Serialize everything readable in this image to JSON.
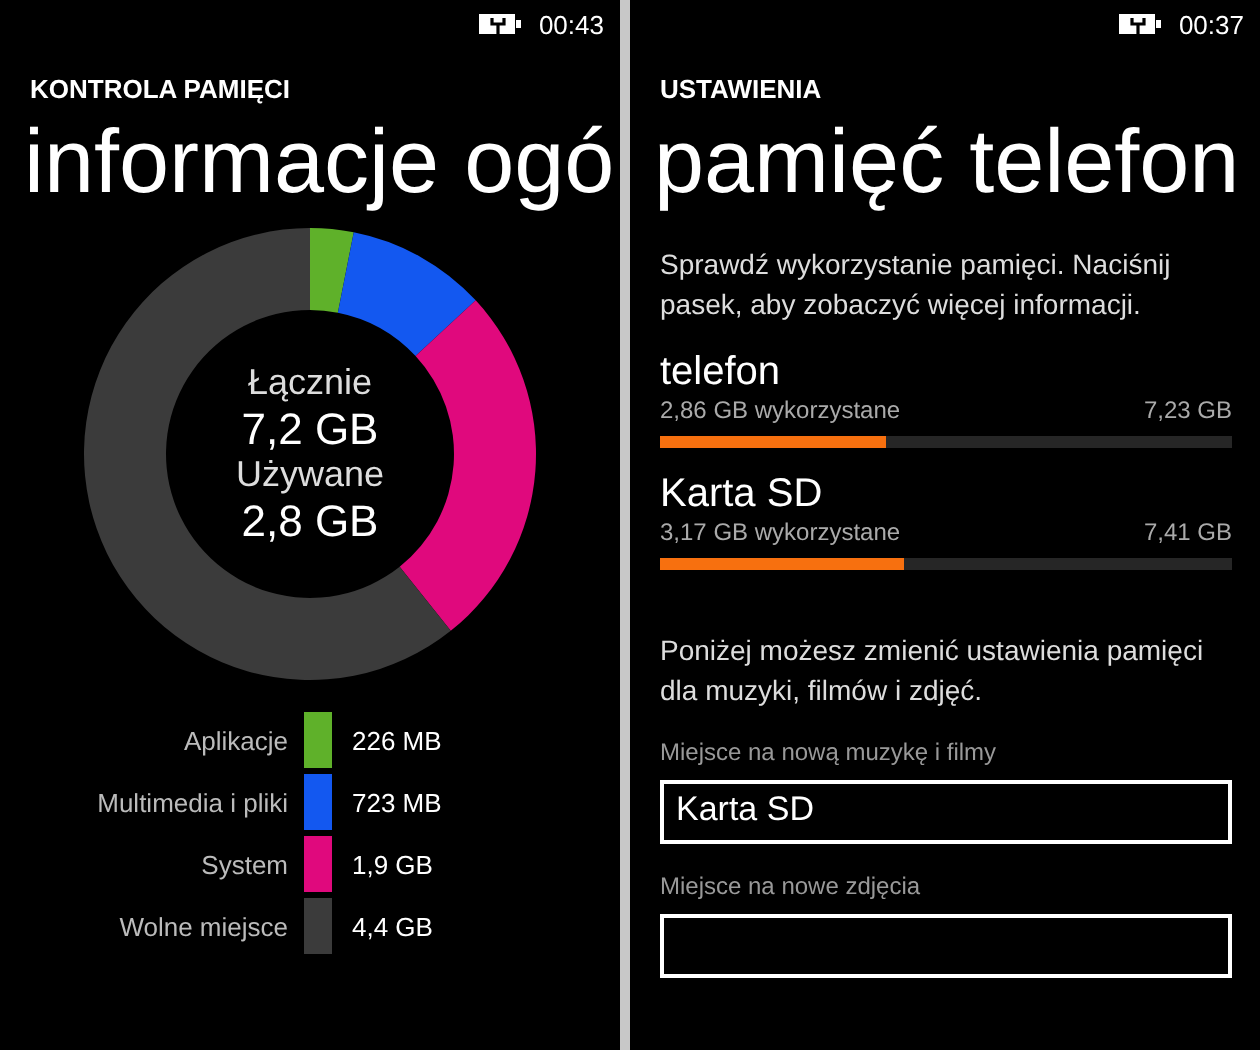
{
  "left": {
    "status_bar": {
      "time": "00:43"
    },
    "app_title": "KONTROLA PAMIĘCI",
    "page_title": "informacje ogó",
    "center": {
      "total_label": "Łącznie",
      "total": "7,2 GB",
      "used_label": "Używane",
      "used": "2,8 GB"
    },
    "chart_data": {
      "type": "donut",
      "categories": [
        "Aplikacje",
        "Multimedia i pliki",
        "System",
        "Wolne miejsce"
      ],
      "values": [
        3.1,
        10.0,
        26.2,
        60.7
      ]
    },
    "legend": [
      {
        "value": "226 MB",
        "color": "#5fb12a"
      },
      {
        "value": "723 MB",
        "color": "#1358f0"
      },
      {
        "value": "1,9 GB",
        "color": "#e0097d"
      },
      {
        "value": "4,4 GB",
        "color": "#3b3b3b"
      }
    ]
  },
  "right": {
    "status_bar": {
      "time": "00:37"
    },
    "app_title": "USTAWIENIA",
    "page_title": "pamięć telefon",
    "intro": "Sprawdź wykorzystanie pamięci. Naciśnij pasek, aby zobaczyć więcej informacji.",
    "storage": [
      {
        "name": "telefon",
        "used": "2,86 GB wykorzystane",
        "total": "7,23 GB",
        "level": 0.396
      },
      {
        "name": "Karta SD",
        "used": "3,17 GB wykorzystane",
        "total": "7,41 GB",
        "level": 0.428
      }
    ],
    "settings_intro": "Poniżej możesz zmienić ustawienia pamięci dla muzyki, filmów i zdjęć.",
    "fields": [
      {
        "label": "Miejsce na nową muzykę i filmy",
        "value": "Karta SD"
      },
      {
        "label": "Miejsce na nowe zdjęcia"
      }
    ]
  }
}
